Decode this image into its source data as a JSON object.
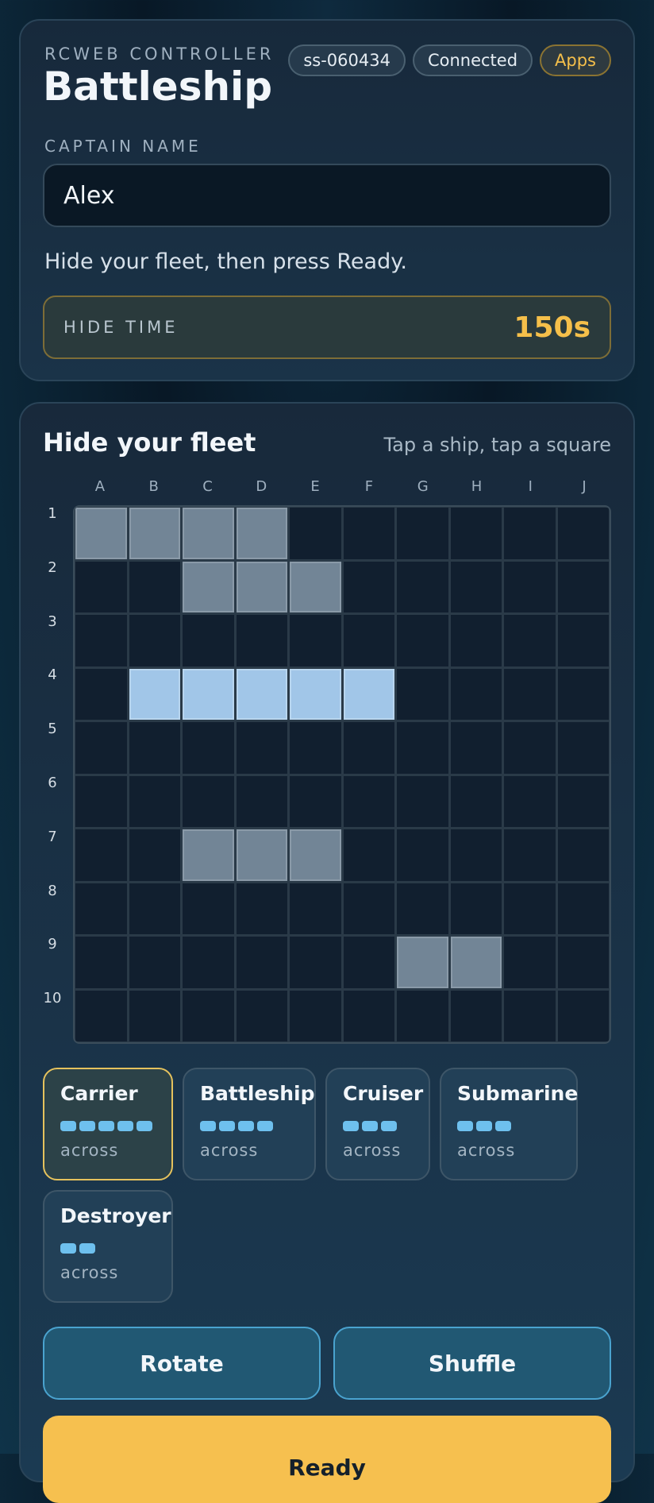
{
  "header": {
    "eyebrow": "RCWEB CONTROLLER",
    "title": "Battleship",
    "session_id": "ss-060434",
    "status": "Connected",
    "apps_label": "Apps"
  },
  "captain": {
    "label": "CAPTAIN NAME",
    "value": "Alex"
  },
  "instruction": "Hide your fleet, then press Ready.",
  "timer": {
    "label": "HIDE TIME",
    "value": "150s"
  },
  "fleet_section": {
    "title": "Hide your fleet",
    "hint": "Tap a ship, tap a square"
  },
  "board": {
    "columns": [
      "A",
      "B",
      "C",
      "D",
      "E",
      "F",
      "G",
      "H",
      "I",
      "J"
    ],
    "rows": [
      "1",
      "2",
      "3",
      "4",
      "5",
      "6",
      "7",
      "8",
      "9",
      "10"
    ],
    "placed_cells": [
      "A1",
      "B1",
      "C1",
      "D1",
      "C2",
      "D2",
      "E2",
      "C7",
      "D7",
      "E7",
      "G9",
      "H9"
    ],
    "selected_cells": [
      "B4",
      "C4",
      "D4",
      "E4",
      "F4"
    ]
  },
  "ships": [
    {
      "name": "Carrier",
      "size": 5,
      "orientation": "across",
      "active": true
    },
    {
      "name": "Battleship",
      "size": 4,
      "orientation": "across",
      "active": false
    },
    {
      "name": "Cruiser",
      "size": 3,
      "orientation": "across",
      "active": false
    },
    {
      "name": "Submarine",
      "size": 3,
      "orientation": "across",
      "active": false
    },
    {
      "name": "Destroyer",
      "size": 2,
      "orientation": "across",
      "active": false
    }
  ],
  "buttons": {
    "rotate": "Rotate",
    "shuffle": "Shuffle",
    "ready": "Ready"
  },
  "colors": {
    "accent": "#f5bf4a",
    "ship_cell": "#728596",
    "selected_cell": "#a1c6e8",
    "button": "#215873"
  }
}
